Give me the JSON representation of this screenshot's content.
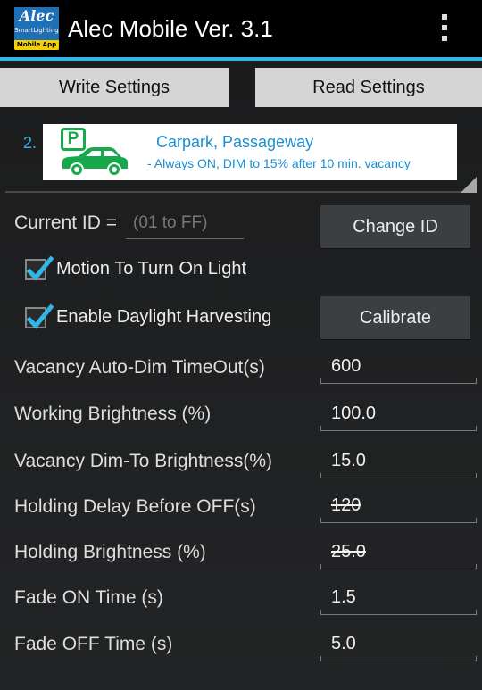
{
  "app": {
    "title": "Alec Mobile Ver. 3.1",
    "logo": {
      "brand": "Alec",
      "sub": "SmartLighting",
      "tag": "Mobile App"
    }
  },
  "toolbar": {
    "write_label": "Write Settings",
    "read_label": "Read Settings",
    "overflow_icon": "overflow-menu-icon"
  },
  "profile": {
    "number": "2.",
    "name": "Carpark, Passageway",
    "description": "- Always ON,  DIM to 15% after 10 min. vacancy",
    "sign_letter": "P",
    "icon": "car-icon"
  },
  "id": {
    "label": "Current ID =",
    "placeholder": "(01 to FF)",
    "button": "Change ID"
  },
  "options": {
    "motion": {
      "label": "Motion To Turn On Light",
      "checked": true
    },
    "daylight": {
      "label": "Enable Daylight Harvesting",
      "checked": true
    },
    "calibrate": "Calibrate"
  },
  "settings": [
    {
      "label": "Vacancy Auto-Dim TimeOut(s)",
      "value": "600"
    },
    {
      "label": "Working Brightness (%)",
      "value": "100.0"
    },
    {
      "label": "Vacancy Dim-To Brightness(%)",
      "value": "15.0"
    },
    {
      "label": "Holding Delay Before OFF(s)",
      "value": "120",
      "disabled": true
    },
    {
      "label": "Holding Brightness (%)",
      "value": "25.0",
      "disabled": true
    },
    {
      "label": "Fade ON Time (s)",
      "value": "1.5"
    },
    {
      "label": "Fade OFF Time (s)",
      "value": "5.0"
    }
  ],
  "colors": {
    "accent": "#33b5e5",
    "sign_green": "#18a84c",
    "profile_text": "#1a8fd0"
  }
}
